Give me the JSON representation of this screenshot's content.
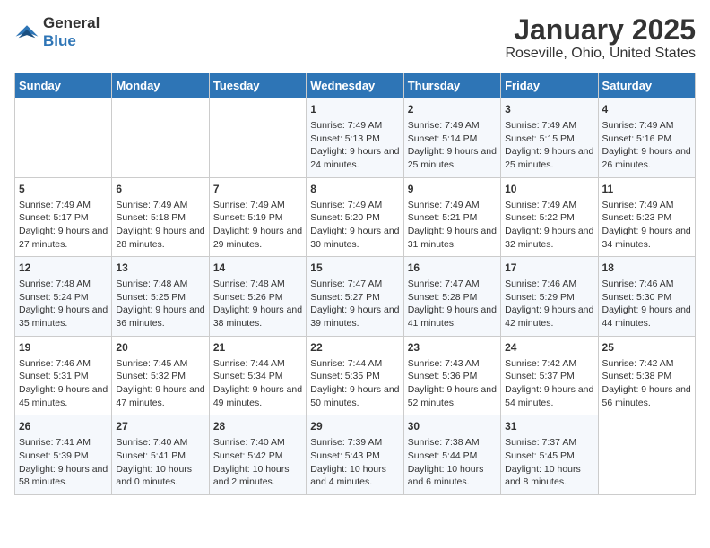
{
  "logo": {
    "general": "General",
    "blue": "Blue"
  },
  "title": "January 2025",
  "subtitle": "Roseville, Ohio, United States",
  "days_of_week": [
    "Sunday",
    "Monday",
    "Tuesday",
    "Wednesday",
    "Thursday",
    "Friday",
    "Saturday"
  ],
  "weeks": [
    [
      {
        "day": "",
        "content": ""
      },
      {
        "day": "",
        "content": ""
      },
      {
        "day": "",
        "content": ""
      },
      {
        "day": "1",
        "content": "Sunrise: 7:49 AM\nSunset: 5:13 PM\nDaylight: 9 hours and 24 minutes."
      },
      {
        "day": "2",
        "content": "Sunrise: 7:49 AM\nSunset: 5:14 PM\nDaylight: 9 hours and 25 minutes."
      },
      {
        "day": "3",
        "content": "Sunrise: 7:49 AM\nSunset: 5:15 PM\nDaylight: 9 hours and 25 minutes."
      },
      {
        "day": "4",
        "content": "Sunrise: 7:49 AM\nSunset: 5:16 PM\nDaylight: 9 hours and 26 minutes."
      }
    ],
    [
      {
        "day": "5",
        "content": "Sunrise: 7:49 AM\nSunset: 5:17 PM\nDaylight: 9 hours and 27 minutes."
      },
      {
        "day": "6",
        "content": "Sunrise: 7:49 AM\nSunset: 5:18 PM\nDaylight: 9 hours and 28 minutes."
      },
      {
        "day": "7",
        "content": "Sunrise: 7:49 AM\nSunset: 5:19 PM\nDaylight: 9 hours and 29 minutes."
      },
      {
        "day": "8",
        "content": "Sunrise: 7:49 AM\nSunset: 5:20 PM\nDaylight: 9 hours and 30 minutes."
      },
      {
        "day": "9",
        "content": "Sunrise: 7:49 AM\nSunset: 5:21 PM\nDaylight: 9 hours and 31 minutes."
      },
      {
        "day": "10",
        "content": "Sunrise: 7:49 AM\nSunset: 5:22 PM\nDaylight: 9 hours and 32 minutes."
      },
      {
        "day": "11",
        "content": "Sunrise: 7:49 AM\nSunset: 5:23 PM\nDaylight: 9 hours and 34 minutes."
      }
    ],
    [
      {
        "day": "12",
        "content": "Sunrise: 7:48 AM\nSunset: 5:24 PM\nDaylight: 9 hours and 35 minutes."
      },
      {
        "day": "13",
        "content": "Sunrise: 7:48 AM\nSunset: 5:25 PM\nDaylight: 9 hours and 36 minutes."
      },
      {
        "day": "14",
        "content": "Sunrise: 7:48 AM\nSunset: 5:26 PM\nDaylight: 9 hours and 38 minutes."
      },
      {
        "day": "15",
        "content": "Sunrise: 7:47 AM\nSunset: 5:27 PM\nDaylight: 9 hours and 39 minutes."
      },
      {
        "day": "16",
        "content": "Sunrise: 7:47 AM\nSunset: 5:28 PM\nDaylight: 9 hours and 41 minutes."
      },
      {
        "day": "17",
        "content": "Sunrise: 7:46 AM\nSunset: 5:29 PM\nDaylight: 9 hours and 42 minutes."
      },
      {
        "day": "18",
        "content": "Sunrise: 7:46 AM\nSunset: 5:30 PM\nDaylight: 9 hours and 44 minutes."
      }
    ],
    [
      {
        "day": "19",
        "content": "Sunrise: 7:46 AM\nSunset: 5:31 PM\nDaylight: 9 hours and 45 minutes."
      },
      {
        "day": "20",
        "content": "Sunrise: 7:45 AM\nSunset: 5:32 PM\nDaylight: 9 hours and 47 minutes."
      },
      {
        "day": "21",
        "content": "Sunrise: 7:44 AM\nSunset: 5:34 PM\nDaylight: 9 hours and 49 minutes."
      },
      {
        "day": "22",
        "content": "Sunrise: 7:44 AM\nSunset: 5:35 PM\nDaylight: 9 hours and 50 minutes."
      },
      {
        "day": "23",
        "content": "Sunrise: 7:43 AM\nSunset: 5:36 PM\nDaylight: 9 hours and 52 minutes."
      },
      {
        "day": "24",
        "content": "Sunrise: 7:42 AM\nSunset: 5:37 PM\nDaylight: 9 hours and 54 minutes."
      },
      {
        "day": "25",
        "content": "Sunrise: 7:42 AM\nSunset: 5:38 PM\nDaylight: 9 hours and 56 minutes."
      }
    ],
    [
      {
        "day": "26",
        "content": "Sunrise: 7:41 AM\nSunset: 5:39 PM\nDaylight: 9 hours and 58 minutes."
      },
      {
        "day": "27",
        "content": "Sunrise: 7:40 AM\nSunset: 5:41 PM\nDaylight: 10 hours and 0 minutes."
      },
      {
        "day": "28",
        "content": "Sunrise: 7:40 AM\nSunset: 5:42 PM\nDaylight: 10 hours and 2 minutes."
      },
      {
        "day": "29",
        "content": "Sunrise: 7:39 AM\nSunset: 5:43 PM\nDaylight: 10 hours and 4 minutes."
      },
      {
        "day": "30",
        "content": "Sunrise: 7:38 AM\nSunset: 5:44 PM\nDaylight: 10 hours and 6 minutes."
      },
      {
        "day": "31",
        "content": "Sunrise: 7:37 AM\nSunset: 5:45 PM\nDaylight: 10 hours and 8 minutes."
      },
      {
        "day": "",
        "content": ""
      }
    ]
  ]
}
